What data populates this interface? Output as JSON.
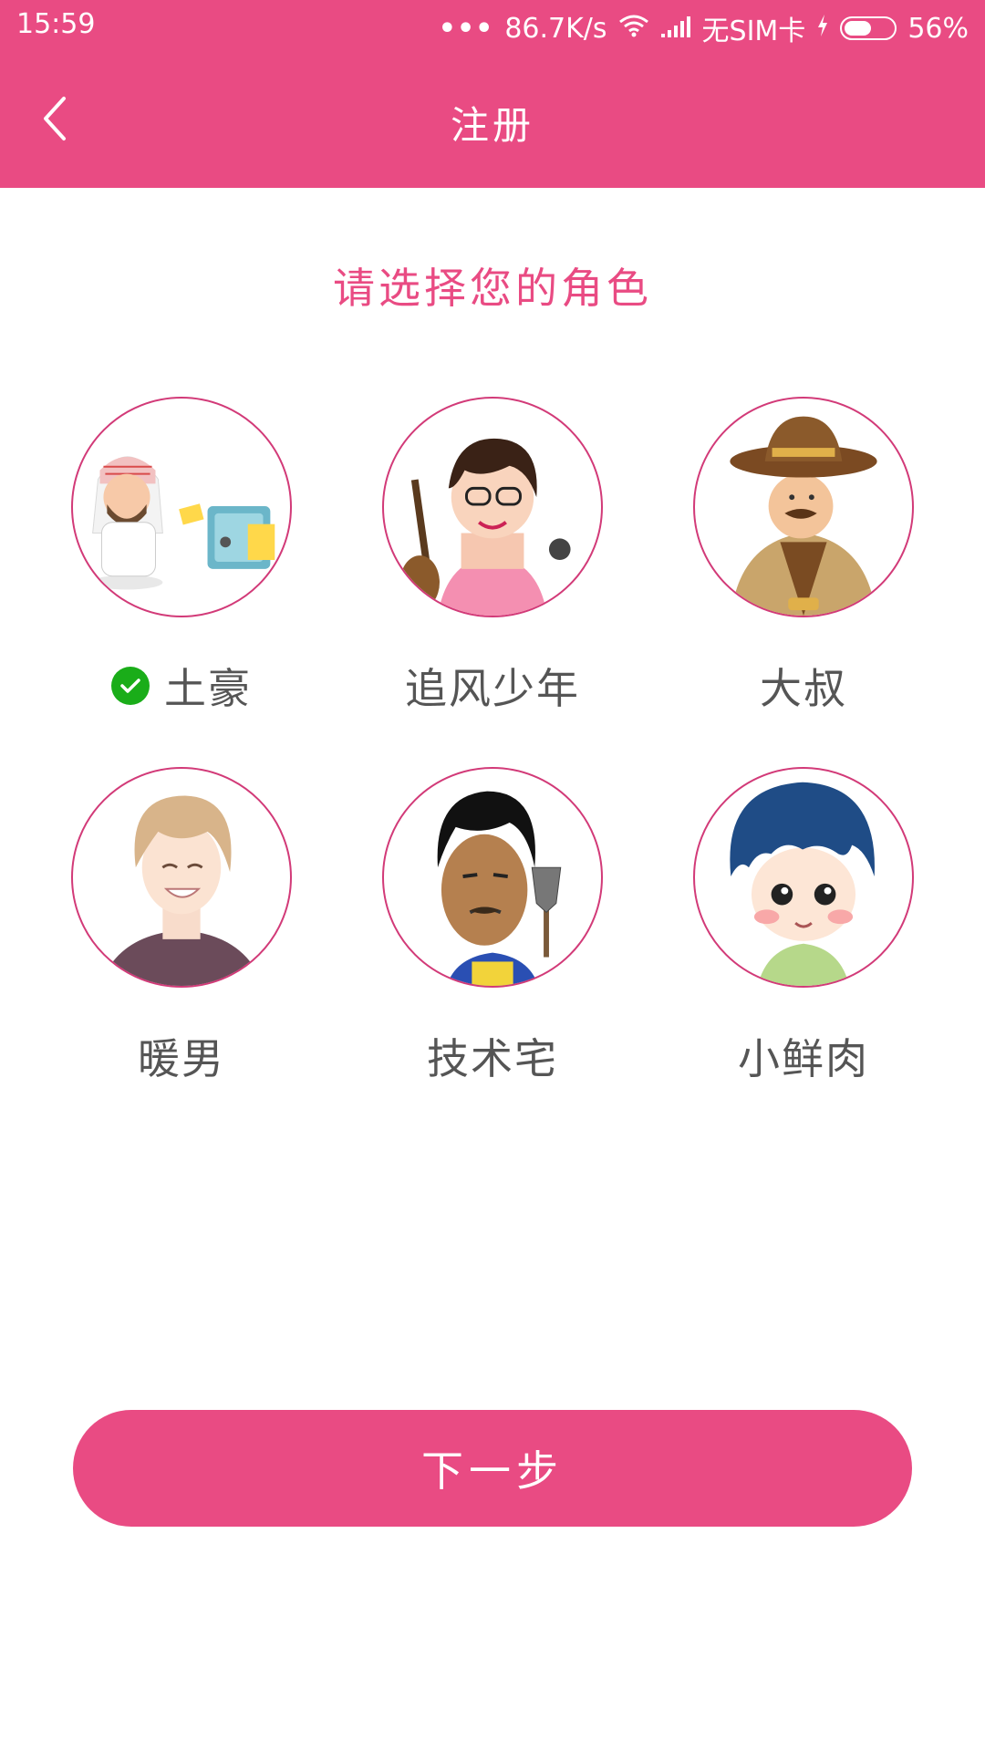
{
  "status_bar": {
    "time": "15:59",
    "network_speed": "86.7K/s",
    "sim": "无SIM卡",
    "battery": "56%",
    "battery_level": 0.56
  },
  "header": {
    "title": "注册",
    "back_icon": "chevron-left-icon"
  },
  "prompt": "请选择您的角色",
  "roles": [
    {
      "label": "土豪",
      "selected": true,
      "avatar": "arab-man-with-safe"
    },
    {
      "label": "追风少年",
      "selected": false,
      "avatar": "boy-with-guitar"
    },
    {
      "label": "大叔",
      "selected": false,
      "avatar": "cowboy-uncle"
    },
    {
      "label": "暖男",
      "selected": false,
      "avatar": "smiling-anime-boy"
    },
    {
      "label": "技术宅",
      "selected": false,
      "avatar": "man-with-shovel"
    },
    {
      "label": "小鲜肉",
      "selected": false,
      "avatar": "chibi-blue-hair-boy"
    }
  ],
  "next_button": "下一步",
  "colors": {
    "accent": "#e94b83",
    "selected_check": "#1aad19",
    "label_text": "#555555"
  }
}
